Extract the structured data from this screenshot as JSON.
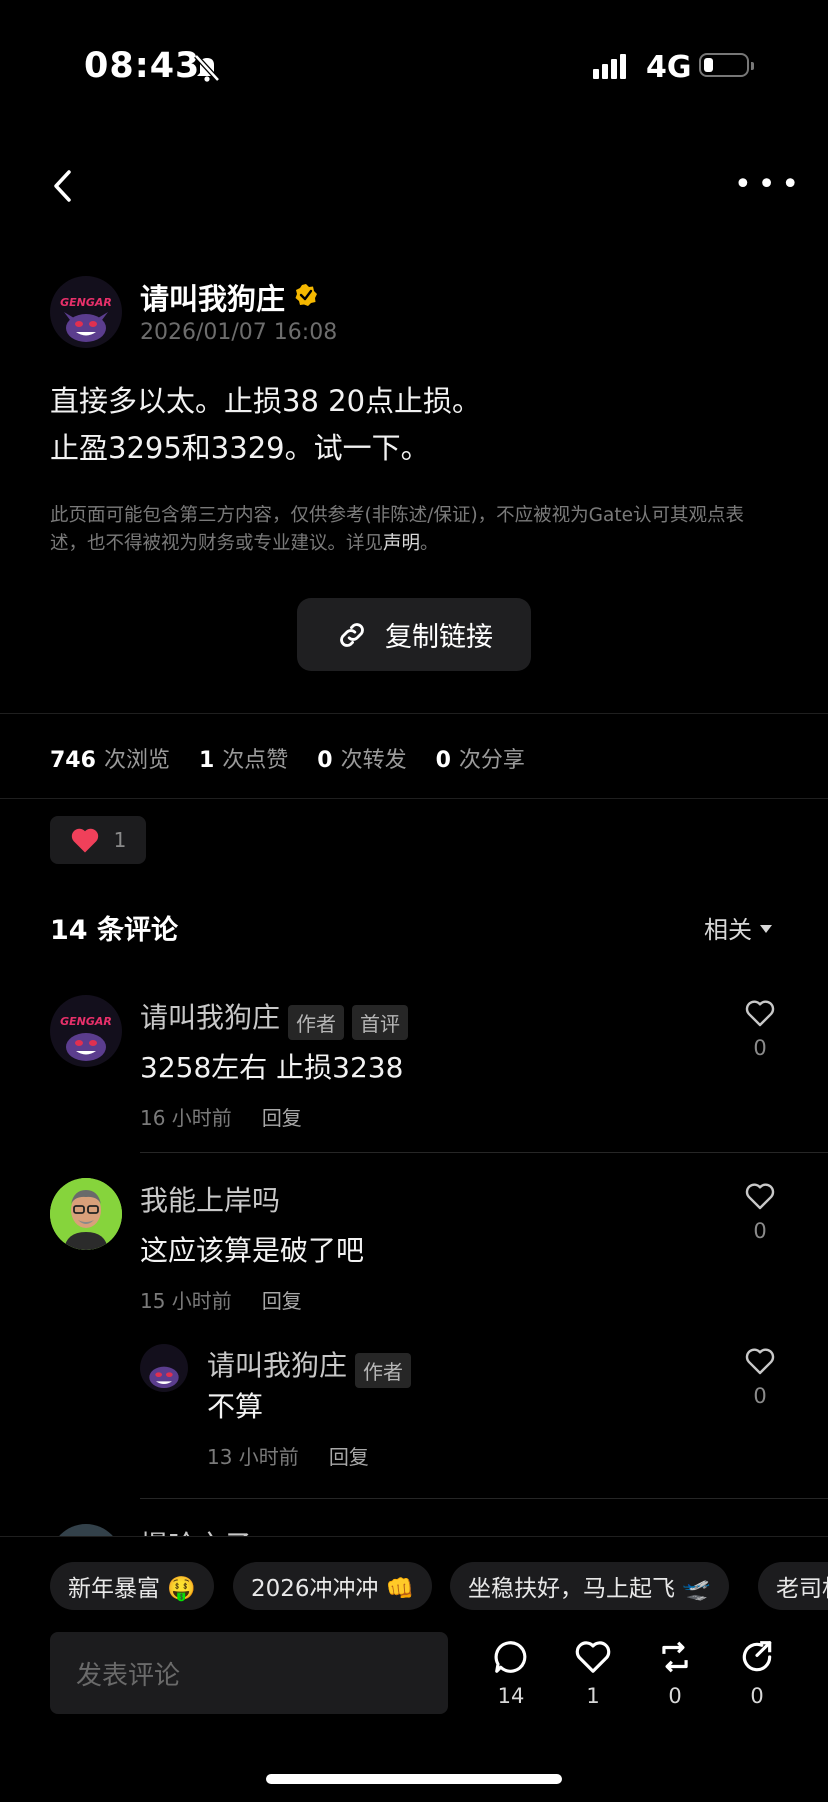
{
  "status_bar": {
    "time": "08:43",
    "network": "4G"
  },
  "post": {
    "author": "请叫我狗庄",
    "date": "2026/01/07 16:08",
    "avatar_text": "GENGAR",
    "body_line1": "直接多以太。止损38 20点止损。",
    "body_line2": "止盈3295和3329。试一下。",
    "disclaimer_main": "此页面可能包含第三方内容，仅供参考(非陈述/保证)，不应被视为Gate认可其观点表述，也不得被视为财务或专业建议。详见",
    "disclaimer_link": "声明",
    "disclaimer_end": "。",
    "copy_link_label": "复制链接"
  },
  "stats": {
    "views": "746",
    "views_label": "次浏览",
    "likes": "1",
    "likes_label": "次点赞",
    "reposts": "0",
    "reposts_label": "次转发",
    "shares": "0",
    "shares_label": "次分享"
  },
  "reaction": {
    "count": "1"
  },
  "comments_header": {
    "title": "14 条评论",
    "sort_label": "相关"
  },
  "comments": [
    {
      "name": "请叫我狗庄",
      "tags": [
        "作者",
        "首评"
      ],
      "text": "3258左右 止损3238",
      "time": "16 小时前",
      "reply": "回复",
      "likes": "0"
    },
    {
      "name": "我能上岸吗",
      "tags": [],
      "text": "这应该算是破了吧",
      "time": "15 小时前",
      "reply": "回复",
      "likes": "0"
    },
    {
      "name": "请叫我狗庄",
      "tags": [
        "作者"
      ],
      "text": "不算",
      "time": "13 小时前",
      "reply": "回复",
      "likes": "0"
    },
    {
      "name": "慢哈之子"
    }
  ],
  "hashtags": [
    "新年暴富 🤑",
    "2026冲冲冲 👊",
    "坐稳扶好，马上起飞 🛫",
    "老司机"
  ],
  "composer": {
    "placeholder": "发表评论"
  },
  "actions": {
    "comments": "14",
    "likes": "1",
    "reposts": "0",
    "shares": "0"
  },
  "colors": {
    "background": "#000000",
    "like_red": "#f0405a",
    "verified": "#f5b800",
    "avatar_green": "#7ed23a"
  }
}
